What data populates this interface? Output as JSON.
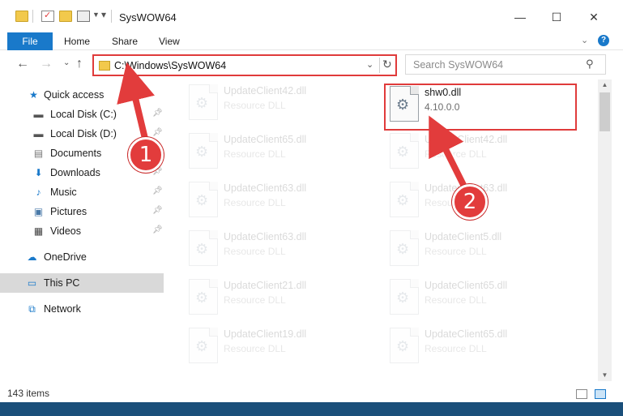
{
  "window": {
    "title": "SysWOW64",
    "minimize_glyph": "—",
    "maximize_glyph": "☐",
    "close_glyph": "✕"
  },
  "ribbon": {
    "tabs": [
      "File",
      "Home",
      "Share",
      "View"
    ],
    "help_glyph": "?"
  },
  "address_bar": {
    "path": "C:\\Windows\\SysWOW64"
  },
  "search": {
    "placeholder": "Search SysWOW64"
  },
  "sidebar": {
    "items": [
      {
        "label": "Quick access",
        "icon": "star-icon"
      },
      {
        "label": "Local Disk (C:)",
        "icon": "drive-icon"
      },
      {
        "label": "Local Disk (D:)",
        "icon": "drive-icon"
      },
      {
        "label": "Documents",
        "icon": "documents-icon"
      },
      {
        "label": "Downloads",
        "icon": "download-icon"
      },
      {
        "label": "Music",
        "icon": "music-icon"
      },
      {
        "label": "Pictures",
        "icon": "pictures-icon"
      },
      {
        "label": "Videos",
        "icon": "videos-icon"
      },
      {
        "label": "OneDrive",
        "icon": "cloud-icon"
      },
      {
        "label": "This PC",
        "icon": "computer-icon",
        "selected": true
      },
      {
        "label": "Network",
        "icon": "network-icon"
      }
    ]
  },
  "files": {
    "left_column": [
      {
        "name": "UpdateClient42.dll",
        "type": "Resource DLL"
      },
      {
        "name": "UpdateClient65.dll",
        "type": "Resource DLL"
      },
      {
        "name": "UpdateClient63.dll",
        "type": "Resource DLL"
      },
      {
        "name": "UpdateClient63.dll",
        "type": "Resource DLL"
      },
      {
        "name": "UpdateClient21.dll",
        "type": "Resource DLL"
      },
      {
        "name": "UpdateClient19.dll",
        "type": "Resource DLL"
      }
    ],
    "right_column": [
      {
        "name": "shw0.dll",
        "type": "4.10.0.0",
        "highlighted": true
      },
      {
        "name": "UpdateClient42.dll",
        "type": "Resource DLL"
      },
      {
        "name": "UpdateClient63.dll",
        "type": "Resource DLL"
      },
      {
        "name": "UpdateClient5.dll",
        "type": "Resource DLL"
      },
      {
        "name": "UpdateClient65.dll",
        "type": "Resource DLL"
      },
      {
        "name": "UpdateClient65.dll",
        "type": "Resource DLL"
      }
    ]
  },
  "status": {
    "item_count": "143 items"
  },
  "annotations": {
    "marker_1": "1",
    "marker_2": "2",
    "color": "#e23c3c"
  }
}
